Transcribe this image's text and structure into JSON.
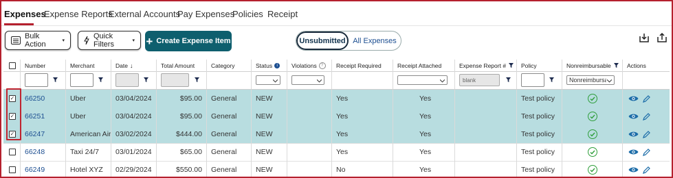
{
  "tabs": [
    "Expenses",
    "Expense Reports",
    "External Accounts",
    "Pay Expenses",
    "Policies",
    "Receipt"
  ],
  "toolbar": {
    "bulk_action": "Bulk Action",
    "quick_filters": "Quick Filters",
    "create_item": "Create Expense Item",
    "toggle_unsubmitted": "Unsubmitted",
    "toggle_all": "All Expenses"
  },
  "columns": {
    "number": "Number",
    "merchant": "Merchant",
    "date": "Date",
    "total_amount": "Total Amount",
    "category": "Category",
    "status": "Status",
    "violations": "Violations",
    "receipt_required": "Receipt Required",
    "receipt_attached": "Receipt Attached",
    "expense_report": "Expense Report #",
    "policy": "Policy",
    "nonreimbursable": "Nonreimbursable",
    "actions": "Actions"
  },
  "filters": {
    "expense_report_value": "blank",
    "nonreimbursable_value": "Nonreimbursable"
  },
  "rows": [
    {
      "number": "66250",
      "merchant": "Uber",
      "date": "03/04/2024",
      "amount": "$95.00",
      "category": "General",
      "status": "NEW",
      "receipt_required": "Yes",
      "receipt_attached": "Yes",
      "policy": "Test policy",
      "selected": true
    },
    {
      "number": "66251",
      "merchant": "Uber",
      "date": "03/04/2024",
      "amount": "$95.00",
      "category": "General",
      "status": "NEW",
      "receipt_required": "Yes",
      "receipt_attached": "Yes",
      "policy": "Test policy",
      "selected": true
    },
    {
      "number": "66247",
      "merchant": "American Airli",
      "date": "03/02/2024",
      "amount": "$444.00",
      "category": "General",
      "status": "NEW",
      "receipt_required": "Yes",
      "receipt_attached": "Yes",
      "policy": "Test policy",
      "selected": true
    },
    {
      "number": "66248",
      "merchant": "Taxi 24/7",
      "date": "03/01/2024",
      "amount": "$65.00",
      "category": "General",
      "status": "NEW",
      "receipt_required": "Yes",
      "receipt_attached": "Yes",
      "policy": "Test policy",
      "selected": false
    },
    {
      "number": "66249",
      "merchant": "Hotel XYZ",
      "date": "02/29/2024",
      "amount": "$550.00",
      "category": "General",
      "status": "NEW",
      "receipt_required": "No",
      "receipt_attached": "Yes",
      "policy": "Test policy",
      "selected": false
    }
  ],
  "colors": {
    "accent_red": "#b5202e",
    "primary_teal": "#0e5f6e",
    "selected_row": "#b8dde0",
    "link_blue": "#1d4f91",
    "check_green": "#2e9e3a"
  }
}
